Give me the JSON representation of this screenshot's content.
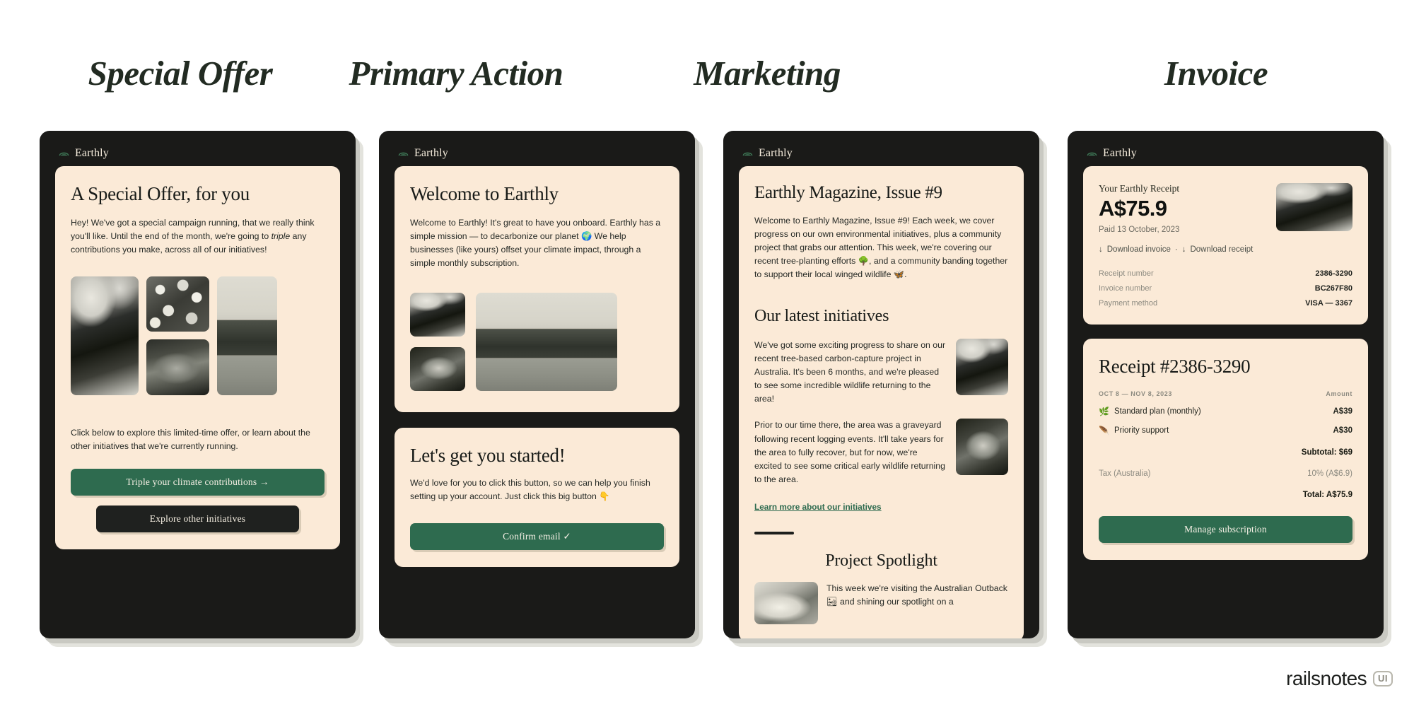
{
  "brand": {
    "name": "Earthly",
    "logo_icon": "leaf-logo-icon"
  },
  "colors": {
    "accent_green": "#2e6b4f",
    "dark": "#1a1a18",
    "cream": "#fbead7",
    "page_bg": "#ffffff"
  },
  "footer": {
    "wordmark": "railsnotes",
    "badge": "UI"
  },
  "panels": [
    {
      "title": "Special Offer",
      "card": {
        "heading": "A Special Offer, for you",
        "paragraph_1a": "Hey! We've got a special campaign running, that we really think you'll like. Until the end of the month, we're going to ",
        "paragraph_1_em": "triple",
        "paragraph_1b": " any contributions you make, across all of our initiatives!",
        "images": [
          "bird-photo",
          "rocks-photo",
          "hills-photo",
          "web-photo"
        ],
        "paragraph_2": "Click below to explore this limited-time offer, or learn about the other initiatives that we're currently running.",
        "primary_button": "Triple your climate contributions →",
        "secondary_button": "Explore other initiatives"
      }
    },
    {
      "title": "Primary Action",
      "card_top": {
        "heading": "Welcome to Earthly",
        "paragraph": "Welcome to Earthly! It's great to have you onboard. Earthly has a simple mission — to decarbonize our planet 🌍 We help businesses (like yours) offset your climate impact, through a simple monthly subscription.",
        "images": [
          "bird-photo",
          "hills-photo",
          "spider-photo"
        ]
      },
      "card_bottom": {
        "heading": "Let's get you started!",
        "paragraph": "We'd love for you to click this button, so we can help you finish setting up your account. Just click this big button 👇",
        "button": "Confirm email ✓"
      }
    },
    {
      "title": "Marketing",
      "card": {
        "heading": "Earthly Magazine, Issue #9",
        "intro": "Welcome to Earthly Magazine, Issue #9! Each week, we cover progress on our own environmental initiatives, plus a community project that grabs our attention. This week, we're covering our recent tree-planting efforts 🌳, and a community banding together to support their local winged wildlife 🦋.",
        "section_heading": "Our latest initiatives",
        "block_1": "We've got some exciting progress to share on our recent tree-based carbon-capture project in Australia. It's been 6 months, and we're pleased to see some incredible wildlife returning to the area!",
        "block_2": "Prior to our time there, the area was a graveyard following recent logging events. It'll take years for the area to fully recover, but for now, we're excited to see some critical early wildlife returning to the area.",
        "link": "Learn more about our initiatives",
        "spotlight_heading": "Project Spotlight",
        "spotlight_text": "This week we're visiting the Australian Outback 🏜 and shining our spotlight on a"
      }
    },
    {
      "title": "Invoice",
      "card_top": {
        "label": "Your Earthly Receipt",
        "amount": "A$75.9",
        "paid": "Paid 13 October, 2023",
        "download_invoice": "Download invoice",
        "separator": "·",
        "download_receipt": "Download receipt",
        "meta": [
          {
            "key": "Receipt number",
            "value": "2386-3290"
          },
          {
            "key": "Invoice number",
            "value": "BC267F80"
          },
          {
            "key": "Payment method",
            "value": "VISA — 3367"
          }
        ]
      },
      "card_bottom": {
        "heading": "Receipt #2386-3290",
        "period": "OCT 8 — NOV 8, 2023",
        "amount_header": "Amount",
        "lines": [
          {
            "icon": "herb-icon",
            "label": "Standard plan (monthly)",
            "amount": "A$39"
          },
          {
            "icon": "feather-icon",
            "label": "Priority support",
            "amount": "A$30"
          }
        ],
        "subtotal": "Subtotal: $69",
        "tax_label": "Tax (Australia)",
        "tax_value": "10% (A$6.9)",
        "total": "Total: A$75.9",
        "button": "Manage subscription"
      }
    }
  ]
}
